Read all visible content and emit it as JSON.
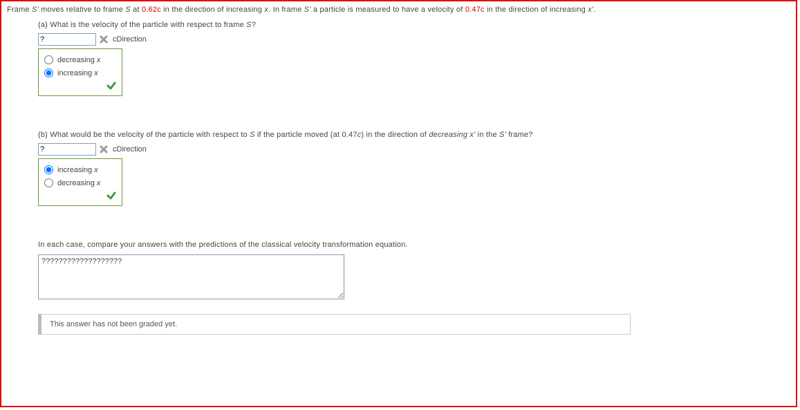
{
  "intro": {
    "t1": "Frame ",
    "s1": "S'",
    "t2": " moves relative to frame ",
    "s2": "S",
    "t3": " at ",
    "v1": "0.62c",
    "t4": " in the direction of increasing ",
    "x1": "x",
    "t5": ". In frame ",
    "s3": "S'",
    "t6": " a particle is measured to have a velocity of ",
    "v2": "0.47c",
    "t7": " in the direction of increasing ",
    "x2": "x'",
    "t8": "."
  },
  "partA": {
    "q1": "(a) What is the velocity of the particle with respect to frame ",
    "qS": "S",
    "q2": "?",
    "input_value": "?",
    "unit": "cDirection",
    "opt1a": "decreasing ",
    "opt1b": "x",
    "opt2a": "increasing ",
    "opt2b": "x"
  },
  "partB": {
    "q1": "(b) What would be the velocity of the particle with respect to ",
    "qS": "S",
    "q2": " if the particle moved (at 0.47",
    "qc": "c",
    "q3": ") in the direction of ",
    "qd": "decreasing x'",
    "q4": " in the ",
    "qS2": "S'",
    "q5": " frame?",
    "input_value": "?",
    "unit": "cDirection",
    "opt1a": "increasing ",
    "opt1b": "x",
    "opt2a": "decreasing ",
    "opt2b": "x"
  },
  "compare": "In each case, compare your answers with the predictions of the classical velocity transformation equation.",
  "textarea_value": "???????????????????",
  "grade_msg": "This answer has not been graded yet."
}
